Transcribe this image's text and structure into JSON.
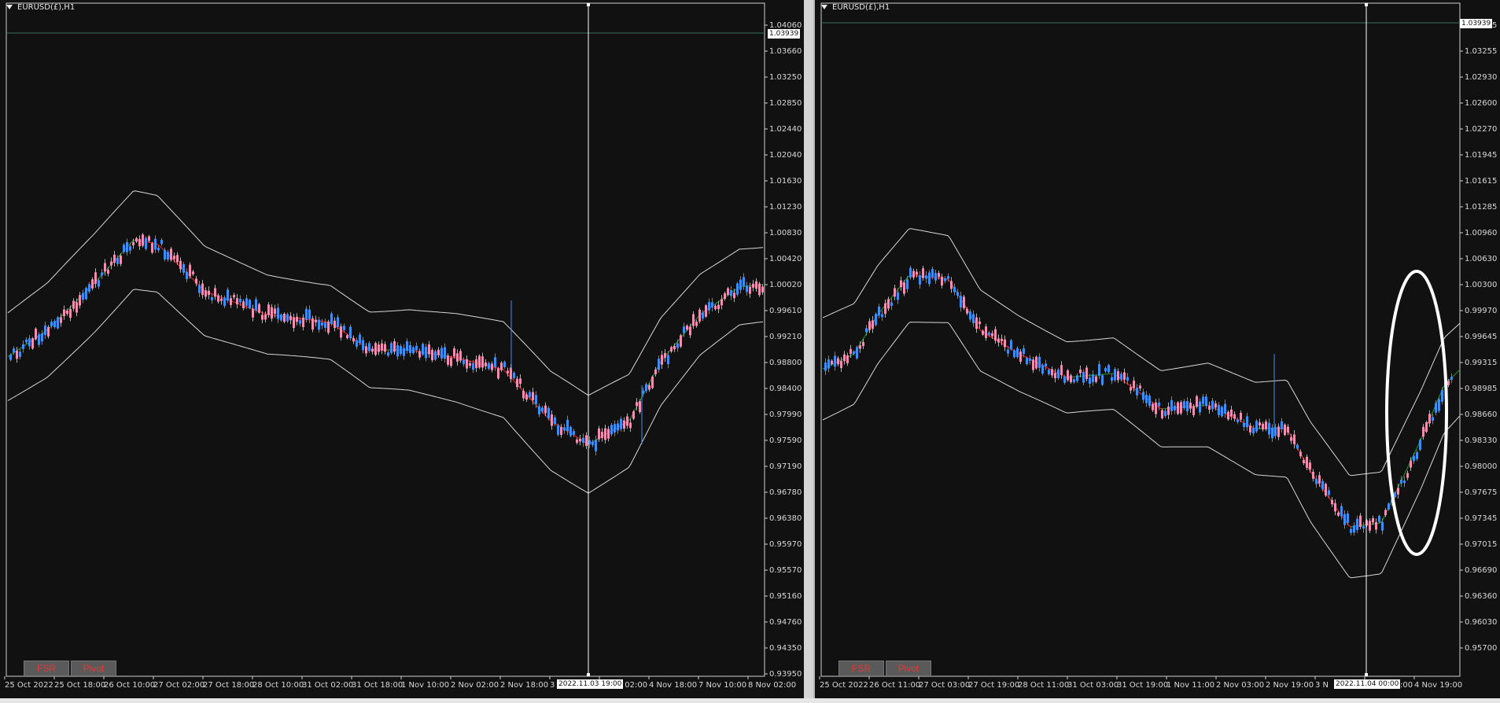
{
  "charts": [
    {
      "id": "left",
      "title": "EURUSD(£),H1",
      "price_flag": "1.03939",
      "date_flag": "2022.11.03 19:00",
      "buttons": [
        "FSR",
        "Pivot"
      ],
      "y_ticks": [
        "1.04060",
        "1.03660",
        "1.03250",
        "1.02850",
        "1.02440",
        "1.02040",
        "1.01630",
        "1.01230",
        "1.00830",
        "1.00420",
        "1.00020",
        "0.99610",
        "0.99210",
        "0.98800",
        "0.98400",
        "0.97990",
        "0.97590",
        "0.97190",
        "0.96780",
        "0.96380",
        "0.95970",
        "0.95570",
        "0.95160",
        "0.94760",
        "0.94350",
        "0.93950"
      ],
      "x_ticks": [
        "25 Oct 2022",
        "25 Oct 18:00",
        "26 Oct 10:00",
        "27 Oct 02:00",
        "27 Oct 18:00",
        "28 Oct 10:00",
        "31 Oct 02:00",
        "31 Oct 18:00",
        "1 Nov 10:00",
        "2 Nov 02:00",
        "2 Nov 18:00",
        "3 Nov 10:00",
        "4 Nov 02:00",
        "4 Nov 18:00",
        "7 Nov 10:00",
        "8 Nov 02:00"
      ]
    },
    {
      "id": "right",
      "title": "EURUSD(£),H1",
      "price_flag": "1.03939",
      "date_flag": "2022.11.04 00:00",
      "buttons": [
        "FSR",
        "Pivot"
      ],
      "y_ticks": [
        "1.03585",
        "1.03255",
        "1.02930",
        "1.02600",
        "1.02270",
        "1.01945",
        "1.01615",
        "1.01285",
        "1.00960",
        "1.00630",
        "1.00300",
        "0.99970",
        "0.99645",
        "0.99315",
        "0.98985",
        "0.98660",
        "0.98330",
        "0.98000",
        "0.97675",
        "0.97345",
        "0.97015",
        "0.96690",
        "0.96360",
        "0.96030",
        "0.95700"
      ],
      "x_ticks": [
        "25 Oct 2022",
        "26 Oct 11:00",
        "27 Oct 03:00",
        "27 Oct 19:00",
        "28 Oct 11:00",
        "31 Oct 03:00",
        "31 Oct 19:00",
        "1 Nov 11:00",
        "2 Nov 03:00",
        "2 Nov 19:00",
        "3 N",
        "4 Nov 03:00",
        "4 Nov 19:00"
      ]
    }
  ],
  "colors": {
    "background": "#111111",
    "bull": "#3d8ef0",
    "bear": "#f08fb0",
    "ma_down": "#e02020",
    "ma_up": "#1f8a2a",
    "band": "#d8d8d8",
    "crosshair": "#ffffff",
    "button_text": "#e53935"
  },
  "icons": {
    "title_marker": "triangle-down-icon"
  }
}
